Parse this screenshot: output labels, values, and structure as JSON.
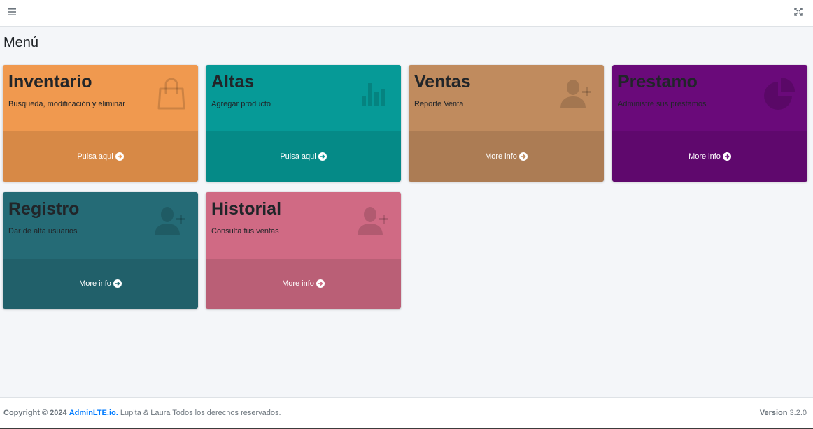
{
  "navbar": {
    "menu_icon": "bars-icon",
    "fullscreen_icon": "expand-arrows-icon"
  },
  "page": {
    "title": "Menú"
  },
  "boxes": [
    {
      "title": "Inventario",
      "subtitle": "Busqueda, modificación y eliminar",
      "link": "Pulsa aqui",
      "icon": "shopping-bag-icon",
      "color": "#f0994f"
    },
    {
      "title": "Altas",
      "subtitle": "Agregar producto",
      "link": "Pulsa aqui",
      "icon": "bar-chart-icon",
      "color": "#069a97"
    },
    {
      "title": "Ventas",
      "subtitle": "Reporte Venta",
      "link": "More info",
      "icon": "user-plus-icon",
      "color": "#c08b5e"
    },
    {
      "title": "Prestamo",
      "subtitle": "Administre sus prestamos",
      "link": "More info",
      "icon": "pie-chart-icon",
      "color": "#6a0a7a"
    },
    {
      "title": "Registro",
      "subtitle": "Dar de alta usuarios",
      "link": "More info",
      "icon": "user-plus-icon",
      "color": "#256b76"
    },
    {
      "title": "Historial",
      "subtitle": "Consulta tus ventas",
      "link": "More info",
      "icon": "user-plus-icon",
      "color": "#d06a84"
    }
  ],
  "footer": {
    "copyright": "Copyright © 2024",
    "brand": "AdminLTE.io.",
    "text": "Lupita & Laura Todos los derechos reservados.",
    "version_label": "Version",
    "version": "3.2.0"
  }
}
